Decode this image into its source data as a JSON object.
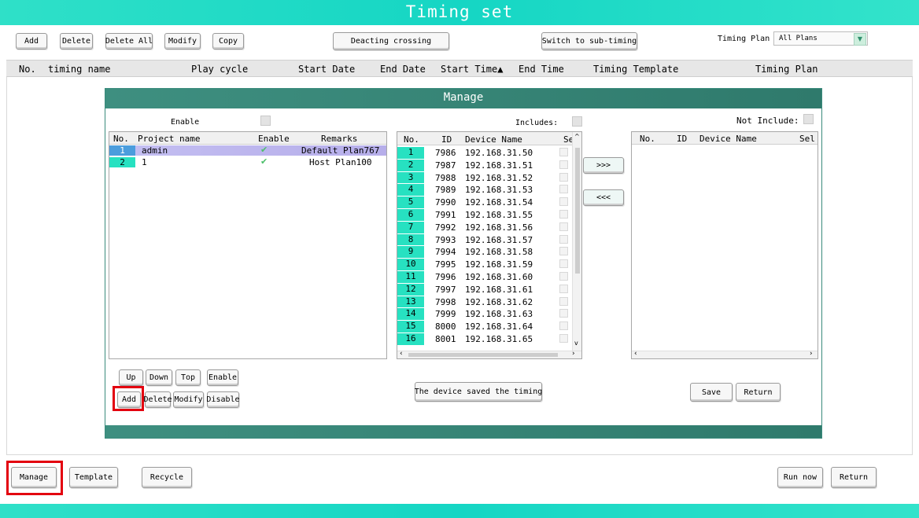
{
  "title": "Timing set",
  "toolbar": {
    "add": "Add",
    "delete": "Delete",
    "delete_all": "Delete All",
    "modify": "Modify",
    "copy": "Copy",
    "deacting_crossing": "Deacting crossing",
    "switch_sub_timing": "Switch to sub-timing",
    "timing_plan_label": "Timing Plan",
    "timing_plan_value": "All Plans"
  },
  "main_table": {
    "columns": [
      "No.",
      "timing name",
      "Play cycle",
      "Start Date",
      "End Date",
      "Start Time▲",
      "End Time",
      "Timing Template",
      "Timing Plan"
    ]
  },
  "manage": {
    "title": "Manage",
    "enable_label": "Enable",
    "includes_label": "Includes:",
    "not_include_label": "Not Include:",
    "project_columns": [
      "No.",
      "Project name",
      "Enable",
      "Remarks"
    ],
    "projects": [
      {
        "no": "1",
        "name": "admin",
        "enabled": true,
        "remarks": "Default Plan767"
      },
      {
        "no": "2",
        "name": "1",
        "enabled": true,
        "remarks": "Host Plan100"
      }
    ],
    "device_columns": [
      "No.",
      "ID",
      "Device Name",
      "Se"
    ],
    "devices": [
      {
        "no": "1",
        "id": "7986",
        "name": "192.168.31.50"
      },
      {
        "no": "2",
        "id": "7987",
        "name": "192.168.31.51"
      },
      {
        "no": "3",
        "id": "7988",
        "name": "192.168.31.52"
      },
      {
        "no": "4",
        "id": "7989",
        "name": "192.168.31.53"
      },
      {
        "no": "5",
        "id": "7990",
        "name": "192.168.31.54"
      },
      {
        "no": "6",
        "id": "7991",
        "name": "192.168.31.55"
      },
      {
        "no": "7",
        "id": "7992",
        "name": "192.168.31.56"
      },
      {
        "no": "8",
        "id": "7993",
        "name": "192.168.31.57"
      },
      {
        "no": "9",
        "id": "7994",
        "name": "192.168.31.58"
      },
      {
        "no": "10",
        "id": "7995",
        "name": "192.168.31.59"
      },
      {
        "no": "11",
        "id": "7996",
        "name": "192.168.31.60"
      },
      {
        "no": "12",
        "id": "7997",
        "name": "192.168.31.61"
      },
      {
        "no": "13",
        "id": "7998",
        "name": "192.168.31.62"
      },
      {
        "no": "14",
        "id": "7999",
        "name": "192.168.31.63"
      },
      {
        "no": "15",
        "id": "8000",
        "name": "192.168.31.64"
      },
      {
        "no": "16",
        "id": "8001",
        "name": "192.168.31.65"
      }
    ],
    "right_columns": [
      "No.",
      "ID",
      "Device Name",
      "Sel"
    ],
    "move_right": ">>>",
    "move_left": "<<<",
    "buttons": {
      "up": "Up",
      "down": "Down",
      "top": "Top",
      "enable": "Enable",
      "add": "Add",
      "delete": "Delete",
      "modify": "Modify",
      "disable": "Disable",
      "device_saved": "The device saved the timing",
      "save": "Save",
      "return": "Return"
    }
  },
  "bottom": {
    "manage": "Manage",
    "template": "Template",
    "recycle": "Recycle",
    "run_now": "Run now",
    "return": "Return"
  },
  "colors": {
    "banner": "#15d6c4",
    "accent": "#27e1c1",
    "highlight_box": "#e3000f",
    "manage_header": "#3a8b7c"
  }
}
